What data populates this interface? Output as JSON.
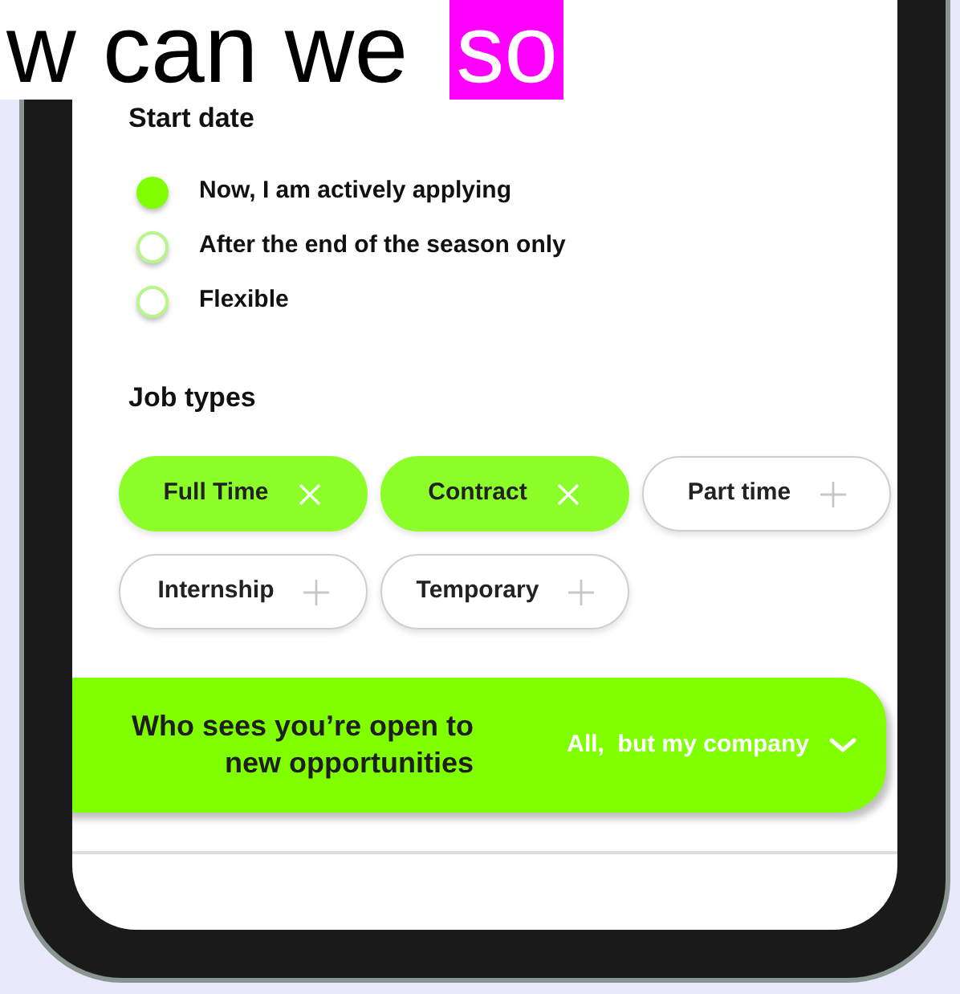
{
  "heading": [
    {
      "text": "w can we",
      "highlighted": false
    },
    {
      "text": "so",
      "highlighted": true
    }
  ],
  "start_date": {
    "title": "Start date",
    "options": [
      {
        "label": "Now, I am actively applying",
        "selected": true
      },
      {
        "label": "After the end of the season only",
        "selected": false
      },
      {
        "label": "Flexible",
        "selected": false
      }
    ]
  },
  "job_types": {
    "title": "Job types",
    "chips": [
      {
        "label": "Full Time",
        "selected": true
      },
      {
        "label": "Contract",
        "selected": true
      },
      {
        "label": "Part time",
        "selected": false
      },
      {
        "label": "Internship",
        "selected": false
      },
      {
        "label": "Temporary",
        "selected": false
      }
    ]
  },
  "visibility": {
    "label": "Who sees you’re open to new opportunities",
    "value": "All,  but my company"
  }
}
